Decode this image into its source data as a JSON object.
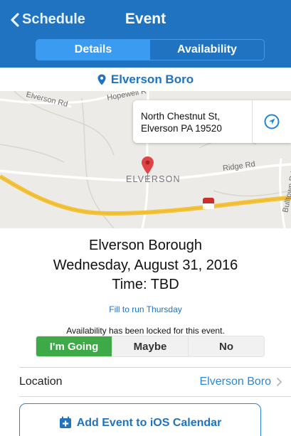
{
  "nav": {
    "back_label": "Schedule",
    "title": "Event",
    "tabs": [
      {
        "label": "Details",
        "active": true
      },
      {
        "label": "Availability",
        "active": false
      }
    ]
  },
  "location_header": {
    "icon": "map-pin-icon",
    "label": "Elverson Boro"
  },
  "map": {
    "callout": {
      "line1": "North Chestnut St,",
      "line2": "Elverson PA 19520",
      "navigate_icon": "navigation-arrow-icon"
    },
    "labels": {
      "elverson_rd": "Elverson Rd",
      "hopewell_rd": "Hopewell R",
      "ridge_rd": "Ridge Rd",
      "bulltown_rd": "Bulltown Rd",
      "town": "ELVERSON"
    },
    "pin_icon": "map-pin-icon"
  },
  "event": {
    "name": "Elverson Borough",
    "date": "Wednesday, August 31, 2016",
    "time": "Time: TBD",
    "note": "Fill to run Thursday"
  },
  "availability": {
    "locked_message": "Availability has been locked for this event.",
    "options": [
      {
        "label": "I'm Going",
        "selected": true
      },
      {
        "label": "Maybe",
        "selected": false
      },
      {
        "label": "No",
        "selected": false
      }
    ]
  },
  "location_row": {
    "label": "Location",
    "value": "Elverson Boro",
    "chevron_icon": "chevron-right-icon"
  },
  "calendar_button": {
    "icon": "calendar-add-icon",
    "label": "Add Event to iOS Calendar"
  },
  "colors": {
    "nav_blue": "#1f73c1",
    "segment_blue": "#3b9bf0",
    "going_green": "#3daa47",
    "link_blue": "#2a86d6"
  }
}
